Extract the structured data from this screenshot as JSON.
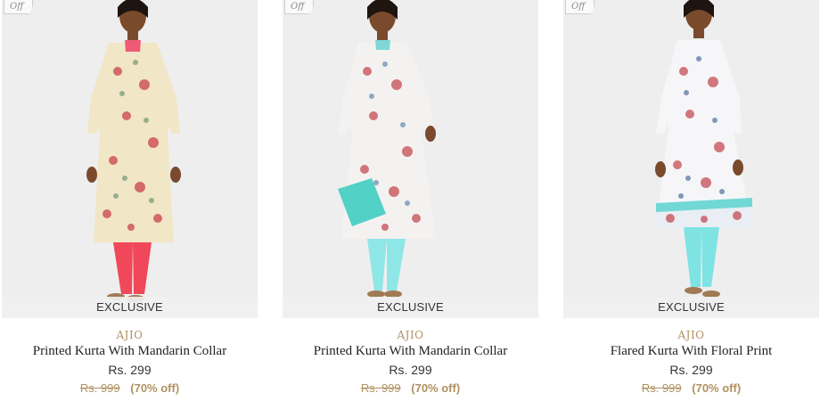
{
  "products": [
    {
      "offer_tag": "Off",
      "badge": "EXCLUSIVE",
      "brand": "AJIO",
      "name": "Printed Kurta With Mandarin Collar",
      "price": "Rs. 299",
      "original_price": "Rs. 999",
      "discount": "(70% off)"
    },
    {
      "offer_tag": "Off",
      "badge": "EXCLUSIVE",
      "brand": "AJIO",
      "name": "Printed Kurta With Mandarin Collar",
      "price": "Rs. 299",
      "original_price": "Rs. 999",
      "discount": "(70% off)"
    },
    {
      "offer_tag": "Off",
      "badge": "EXCLUSIVE",
      "brand": "AJIO",
      "name": "Flared Kurta With Floral Print",
      "price": "Rs. 299",
      "original_price": "Rs. 999",
      "discount": "(70% off)"
    }
  ],
  "colors": {
    "brand_gold": "#b09161",
    "image_bg": "#eeeeee",
    "kurta_1": "#f1e6c6",
    "leggings_1": "#f0485a",
    "kurta_2": "#f4f2f0",
    "leggings_2": "#8fe6e6",
    "kurta_3": "#f6f6f8",
    "leggings_3": "#7fe3e3"
  }
}
